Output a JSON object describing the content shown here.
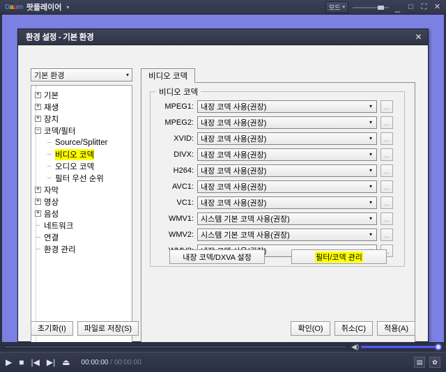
{
  "player": {
    "logo": {
      "brand": "Daum",
      "icon": "daum-logo"
    },
    "app_name": "팟플레이어",
    "app_caret": "▾",
    "mode_button": {
      "label": "모드",
      "caret": "▾",
      "icon": "mode-icon"
    },
    "window_controls": {
      "minimize": "_",
      "maximize": "□",
      "fullscreen": "⛶",
      "close": "✕"
    }
  },
  "dialog": {
    "title": "환경 설정 - 기본 환경",
    "close_label": "✕",
    "env_select": {
      "value": "기본 환경",
      "caret": "▾"
    },
    "tree": [
      {
        "label": "기본",
        "level": 0,
        "node": "expander",
        "expander": "+",
        "highlight": false
      },
      {
        "label": "재생",
        "level": 0,
        "node": "expander",
        "expander": "+",
        "highlight": false
      },
      {
        "label": "장치",
        "level": 0,
        "node": "expander",
        "expander": "+",
        "highlight": false
      },
      {
        "label": "코덱/필터",
        "level": 0,
        "node": "expander",
        "expander": "−",
        "highlight": false
      },
      {
        "label": "Source/Splitter",
        "level": 1,
        "node": "leaf",
        "expander": "",
        "highlight": false
      },
      {
        "label": "비디오 코덱",
        "level": 1,
        "node": "leaf",
        "expander": "",
        "highlight": true
      },
      {
        "label": "오디오 코덱",
        "level": 1,
        "node": "leaf",
        "expander": "",
        "highlight": false
      },
      {
        "label": "필터 우선 순위",
        "level": 1,
        "node": "leaf",
        "expander": "",
        "highlight": false
      },
      {
        "label": "자막",
        "level": 0,
        "node": "expander",
        "expander": "+",
        "highlight": false
      },
      {
        "label": "영상",
        "level": 0,
        "node": "expander",
        "expander": "+",
        "highlight": false
      },
      {
        "label": "음성",
        "level": 0,
        "node": "expander",
        "expander": "+",
        "highlight": false
      },
      {
        "label": "네트워크",
        "level": 0,
        "node": "leaf",
        "expander": "",
        "highlight": false
      },
      {
        "label": "연결",
        "level": 0,
        "node": "leaf",
        "expander": "",
        "highlight": false
      },
      {
        "label": "환경 관리",
        "level": 0,
        "node": "leaf",
        "expander": "",
        "highlight": false
      }
    ],
    "tab": {
      "label": "비디오 코덱"
    },
    "group": {
      "title": "비디오 코덱",
      "rows": [
        {
          "label": "MPEG1:",
          "value": "내장 코덱 사용(권장)",
          "caret": "▾",
          "more": "..."
        },
        {
          "label": "MPEG2:",
          "value": "내장 코덱 사용(권장)",
          "caret": "▾",
          "more": "..."
        },
        {
          "label": "XVID:",
          "value": "내장 코덱 사용(권장)",
          "caret": "▾",
          "more": "..."
        },
        {
          "label": "DIVX:",
          "value": "내장 코덱 사용(권장)",
          "caret": "▾",
          "more": "..."
        },
        {
          "label": "H264:",
          "value": "내장 코덱 사용(권장)",
          "caret": "▾",
          "more": "..."
        },
        {
          "label": "AVC1:",
          "value": "내장 코덱 사용(권장)",
          "caret": "▾",
          "more": "..."
        },
        {
          "label": "VC1:",
          "value": "내장 코덱 사용(권장)",
          "caret": "▾",
          "more": "..."
        },
        {
          "label": "WMV1:",
          "value": "시스템 기본 코덱 사용(권장)",
          "caret": "▾",
          "more": "..."
        },
        {
          "label": "WMV2:",
          "value": "시스템 기본 코덱 사용(권장)",
          "caret": "▾",
          "more": "..."
        },
        {
          "label": "WMV3:",
          "value": "내장 코덱 사용(권장)",
          "caret": "▾",
          "more": "..."
        }
      ],
      "buttons": {
        "dxva_settings": "내장 코덱/DXVA 설정",
        "filter_codec_manage": "필터/코덱 관리"
      }
    },
    "footer": {
      "reset": "초기화(I)",
      "save_to_file": "파일로 저장(S)",
      "ok": "확인(O)",
      "cancel": "취소(C)",
      "apply": "적용(A)"
    }
  },
  "controls": {
    "play": "▶",
    "stop": "■",
    "prev": "|◀",
    "next": "▶|",
    "eject": "⏏",
    "time_current": "00:00:00",
    "time_separator": " / ",
    "time_total": "00:00:00",
    "playlist": "▤",
    "settings": "✿",
    "volume_icon": "🔊"
  },
  "colors": {
    "video_background": "#7b80e2",
    "chrome_dark": "#2b3044",
    "highlight_yellow": "#ffff00",
    "accent_blue": "#5b63ff"
  }
}
